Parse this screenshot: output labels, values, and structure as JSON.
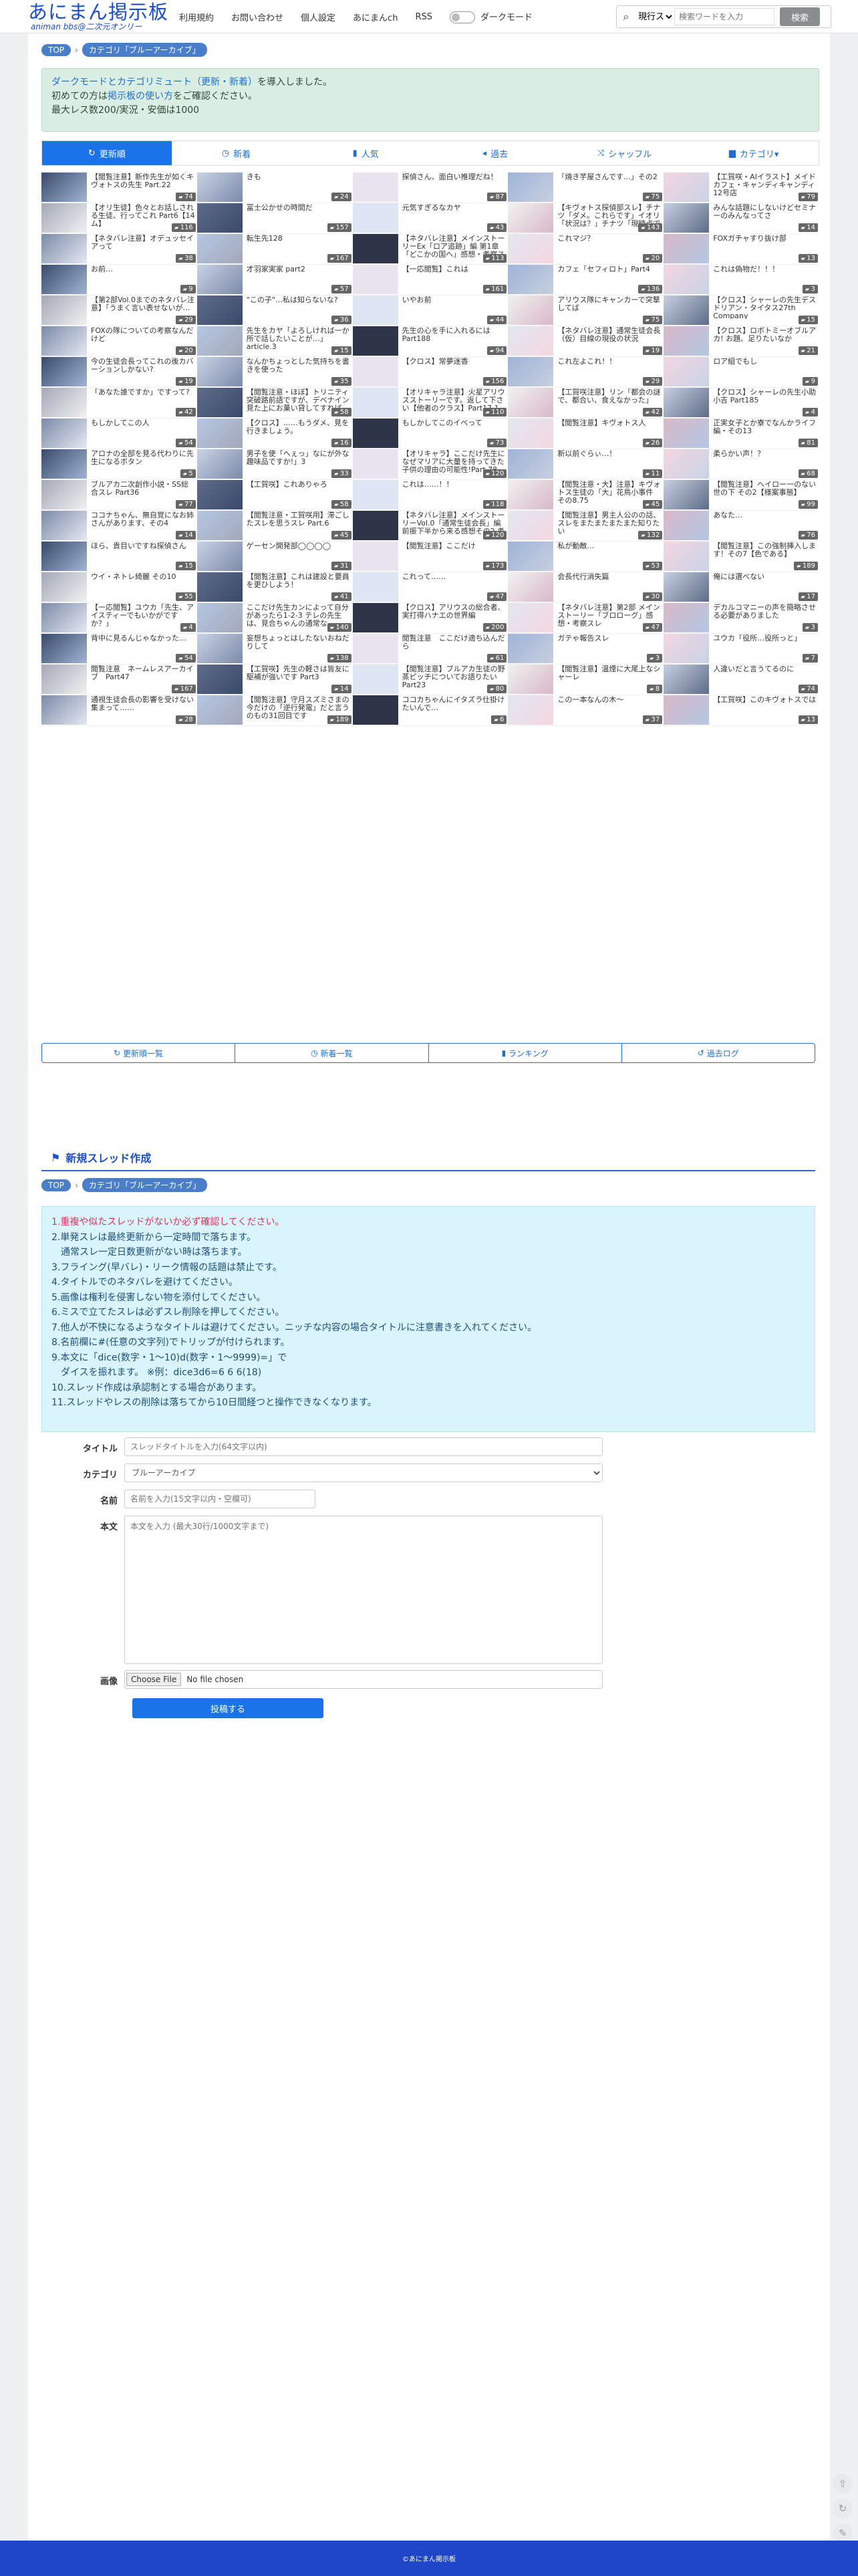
{
  "header": {
    "logo_main": "あにまん掲示板",
    "logo_sub": "animan bbs@二次元オンリー",
    "nav": [
      "利用規約",
      "お問い合わせ",
      "個人設定",
      "あにまんch",
      "RSS"
    ],
    "dark_mode_label": "ダークモード",
    "search_scope": "現行スレ",
    "search_placeholder": "検索ワードを入力",
    "search_button": "検索"
  },
  "breadcrumb": [
    "TOP",
    "カテゴリ「ブルーアーカイブ」"
  ],
  "notice": {
    "line1a": "ダークモードとカテゴリミュート（更新・新着）",
    "line1b": "を導入しました。",
    "line2a": "初めての方は",
    "line2b": "掲示板の使い方",
    "line2c": "をご確認ください。",
    "line3": "最大レス数200/実況・安価は1000"
  },
  "tabs": [
    "更新順",
    "新着",
    "人気",
    "過去",
    "シャッフル",
    "カテゴリ▾"
  ],
  "threads": [
    {
      "t": "【閲覧注意】新作先生が如くキヴォトスの先生 Part.22",
      "c": "74"
    },
    {
      "t": "きも",
      "c": "24"
    },
    {
      "t": "探偵さん、面白い推理だね！",
      "c": "87"
    },
    {
      "t": "「焼き芋屋さんです…」その2",
      "c": "75"
    },
    {
      "t": "【工賀咲・AIイラスト】メイドカフェ・キャンディキャンディ 12号店",
      "c": "79"
    },
    {
      "t": "【オリ生徒】色々とお話しされる生徒、行ってこれ Part6【14ム】",
      "c": "116"
    },
    {
      "t": "冨士公かせの時間だ",
      "c": "157"
    },
    {
      "t": "元気すぎるなカヤ",
      "c": "43"
    },
    {
      "t": "【キヴォトス探偵部スレ】チナツ「ダメ。これらです」イオリ「状況は？」チナツ「現時点でまだ確認が出来てません」",
      "c": "143"
    },
    {
      "t": "みんな話題にしないけどセミナーのみんなってさ",
      "c": "14"
    },
    {
      "t": "【ネタバレ注意】オデュッセイアって",
      "c": "38"
    },
    {
      "t": "転生先128",
      "c": "167"
    },
    {
      "t": "【ネタバレ注意】メインストーリーEx「ロア追跡」編 第1章「どこかの国へ」感想・考察スレ",
      "c": "113"
    },
    {
      "t": "これマジ？",
      "c": "20"
    },
    {
      "t": "FOXガチャすり抜け部",
      "c": "13"
    },
    {
      "t": "お前…",
      "c": "9"
    },
    {
      "t": "才羽家実家 part2",
      "c": "57"
    },
    {
      "t": "【一応閲覧】これは",
      "c": "161"
    },
    {
      "t": "カフェ「セフィロト」Part4",
      "c": "136"
    },
    {
      "t": "これは偽物だ！！！",
      "c": "3"
    },
    {
      "t": "【第2部Vol.0までのネタバレ注意】「うまく言い表せないが…",
      "c": "29"
    },
    {
      "t": "\"この子\"…私は知らないな?",
      "c": "36"
    },
    {
      "t": "いやお前",
      "c": "44"
    },
    {
      "t": "アリウス隊にキャンカーで突撃してば",
      "c": "75"
    },
    {
      "t": "【クロス】シャーレの先生デスドリアン・タイタス27th Company",
      "c": "15"
    },
    {
      "t": "FOXの隊についての考察なんだけど",
      "c": "20"
    },
    {
      "t": "先生をカヤ「よろしければ一か所で話したいことが…」article.3",
      "c": "15"
    },
    {
      "t": "先生の心を手に入れるにはPart188",
      "c": "94"
    },
    {
      "t": "【ネタバレ注意】通常生徒会長（仮）目線の現役の状況",
      "c": "19"
    },
    {
      "t": "【クロス】ロボトミーオブルアカ! お題、足りたいなか",
      "c": "21"
    },
    {
      "t": "今の生徒会長ってこれの後カバーションしかない?",
      "c": "19"
    },
    {
      "t": "なんかちょっとした気持ちを書きを使った",
      "c": "35"
    },
    {
      "t": "【クロス】常夢迷香",
      "c": "156"
    },
    {
      "t": "これ左よこれ！！",
      "c": "29"
    },
    {
      "t": "ロア組でもし",
      "c": "9"
    },
    {
      "t": "「あなた誰ですか」ですって?",
      "c": "42"
    },
    {
      "t": "【閲覧注意・ほぼ】トリニティ突破路前語ですが、デベナイン見た上にお菓い貸してすれば…",
      "c": "58"
    },
    {
      "t": "【オリキャラ注意】火星アリウスストーリーです。返して下さい【他者のクラス】Part17.1",
      "c": "110"
    },
    {
      "t": "【工賀咲注意】リン「都会の謎で、都合い、食えなかった」",
      "c": "42"
    },
    {
      "t": "【クロス】シャーレの先生小助小吉 Part185",
      "c": "4"
    },
    {
      "t": "もしかしてこの人",
      "c": "54"
    },
    {
      "t": "【クロス】……もうダメ、見を行きましょう。",
      "c": "16"
    },
    {
      "t": "もしかしてこのイベって",
      "c": "73"
    },
    {
      "t": "【閲覧注意】キヴォトス人",
      "c": "26"
    },
    {
      "t": "正実女子とか寮でなんかライフ編・その13",
      "c": "81"
    },
    {
      "t": "アロナの全部を見る代わりに先生になるボタン",
      "c": "5"
    },
    {
      "t": "男子を使「へぇっ」なにが外な趣味品ですか!」3",
      "c": "33"
    },
    {
      "t": "【オリキャラ】ここだけ先生になぜマリアに大量を持ってきた子供の理由の可能性!Part.78",
      "c": "120"
    },
    {
      "t": "新以前ぐらぃ…！",
      "c": "11"
    },
    {
      "t": "柔らかい声！？",
      "c": "68"
    },
    {
      "t": "ブルアカ二次創作小説・SS総合スレ Part36",
      "c": "77"
    },
    {
      "t": "【工賀咲】これありゃろ",
      "c": "58"
    },
    {
      "t": "これは……！！",
      "c": "118"
    },
    {
      "t": "【閲覧注意・大】注意】キヴォトス生徒の「大」花鳥小事件 その8.75",
      "c": "45"
    },
    {
      "t": "【閲覧注意】ヘイロー一のない世の下 その2【様案事態】",
      "c": "99"
    },
    {
      "t": "ココナちゃん、無自覚になお姉さんがあります、その4",
      "c": "14"
    },
    {
      "t": "【閲覧注意・工賀咲用】滞ごしたスレを思うスレ Part.6",
      "c": "45"
    },
    {
      "t": "【ネタバレ注意】メインストーリーVol.0「通常生徒会長」編 前振下半から来る感想その2 考察スレ",
      "c": "120"
    },
    {
      "t": "【閲覧注意】男主人公のの話、スレをまたまたまたまた知りたい",
      "c": "132"
    },
    {
      "t": "あなた…",
      "c": "76"
    },
    {
      "t": "ほら、貴目いですね探偵さん",
      "c": "15"
    },
    {
      "t": "ゲーセン開発部◯◯◯◯",
      "c": "31"
    },
    {
      "t": "【閲覧注意】ここだけ",
      "c": "173"
    },
    {
      "t": "私が動敵…",
      "c": "53"
    },
    {
      "t": "【閲覧注意】この強制挿入します！その7【色である】",
      "c": "189"
    },
    {
      "t": "ウイ・ネトレ綺麗 その10",
      "c": "55"
    },
    {
      "t": "【閲覧注意】これは建設と要員を更ひしよう！",
      "c": "41"
    },
    {
      "t": "これって……",
      "c": "47"
    },
    {
      "t": "会長代行消失篇",
      "c": "30"
    },
    {
      "t": "俺には選べない",
      "c": "17"
    },
    {
      "t": "【一応閲覧】ユウカ「先生、アイスティーでもいかがですか？」",
      "c": "4"
    },
    {
      "t": "ここだけ先生カンによって自分があったら1-2-3 テレの先生は、見合ちゃんの通常な…",
      "c": "140"
    },
    {
      "t": "【クロス】アリウスの総合者、実打得ハナエの世界編",
      "c": "200"
    },
    {
      "t": "【ネタバレ注意】第2部 メインストーリー「ブロローグ」感想・考察スレ",
      "c": "47"
    },
    {
      "t": "デカルコマニーの声を簡略させる必要がありました",
      "c": "3"
    },
    {
      "t": "背中に見るんじゃなかった…",
      "c": "54"
    },
    {
      "t": "妄想ちょっとはしたないおねだりして",
      "c": "138"
    },
    {
      "t": "閲覧注意　ここだけ適ち込んだら",
      "c": "61"
    },
    {
      "t": "ガテゃ報告スレ",
      "c": "3"
    },
    {
      "t": "ユウカ「役所…役所っと」",
      "c": "7"
    },
    {
      "t": "閲覧注意　ネームレスアーカイブ　Part47",
      "c": "167"
    },
    {
      "t": "【工賀咲】先生の軽さは皆友に駆補が強いです Part3",
      "c": "14"
    },
    {
      "t": "【閲覧注意】ブルアカ生徒の野蒸ピッチについてお語りたい　Part23",
      "c": "80"
    },
    {
      "t": "【閲覧注意】温煙に大尾上なシャーレ",
      "c": "8"
    },
    {
      "t": "人違いだと言うてるのに",
      "c": "74"
    },
    {
      "t": "通視生徒会長の影響を受けない集まって……",
      "c": "28"
    },
    {
      "t": "【閲覧注意】守月スズミさまの今だけの「逆行発電」だと言うのもの31回目です",
      "c": "189"
    },
    {
      "t": "ココカちゃんにイタズラ仕掛けたいんで…",
      "c": "6"
    },
    {
      "t": "この一本なんの木〜",
      "c": "37"
    },
    {
      "t": "【工賀咲】このキヴォトスでは",
      "c": "13"
    }
  ],
  "thumb_colors": [
    "#3a4a6b",
    "#c9d3e6",
    "#e9e4f0",
    "#9fb4d6",
    "#f4d6e0",
    "#a4a8b8",
    "#5e6c88",
    "#dde6f2",
    "#f1f1f1",
    "#c7cfe0",
    "#7d8aa8",
    "#b5c7e4",
    "#2f3548",
    "#e3e8f1",
    "#d9b9c8"
  ],
  "bottom_links": [
    "更新順一覧",
    "新着一覧",
    "ランキング",
    "過去ログ"
  ],
  "new_thread": {
    "heading": "新規スレッド作成",
    "breadcrumb": [
      "TOP",
      "カテゴリ「ブルーアーカイブ」"
    ],
    "rules": [
      "1.重複や似たスレッドがないか必ず確認してください。",
      "2.単発スレは最終更新から一定時間で落ちます。",
      "　通常スレ一定日数更新がない時は落ちます。",
      "3.フライング(早バレ)・リーク情報の話題は禁止です。",
      "4.タイトルでのネタバレを避けてください。",
      "5.画像は権利を侵害しない物を添付してください。",
      "6.ミスで立てたスレは必ずスレ削除を押してください。",
      "7.他人が不快になるようなタイトルは避けてください。ニッチな内容の場合タイトルに注意書きを入れてください。",
      "8.名前欄に#(任意の文字列)でトリップが付けられます。",
      "9.本文に「dice(数字・1〜10)d(数字・1〜9999)=」で",
      "　ダイスを振れます。 ※例：dice3d6=6 6 6(18)",
      "10.スレッド作成は承認制とする場合があります。",
      "11.スレッドやレスの削除は落ちてから10日間経つと操作できなくなります。"
    ],
    "title_label": "タイトル",
    "title_placeholder": "スレッドタイトルを入力(64文字以内)",
    "category_label": "カテゴリ",
    "category_value": "ブルーアーカイブ",
    "name_label": "名前",
    "name_placeholder": "名前を入力(15文字以内・空欄可)",
    "body_label": "本文",
    "body_placeholder": "本文を入力 (最大30行/1000文字まで)",
    "image_label": "画像",
    "file_button": "Choose File",
    "file_status": "No file chosen",
    "submit": "投稿する"
  },
  "footer": "©あにまん掲示板"
}
